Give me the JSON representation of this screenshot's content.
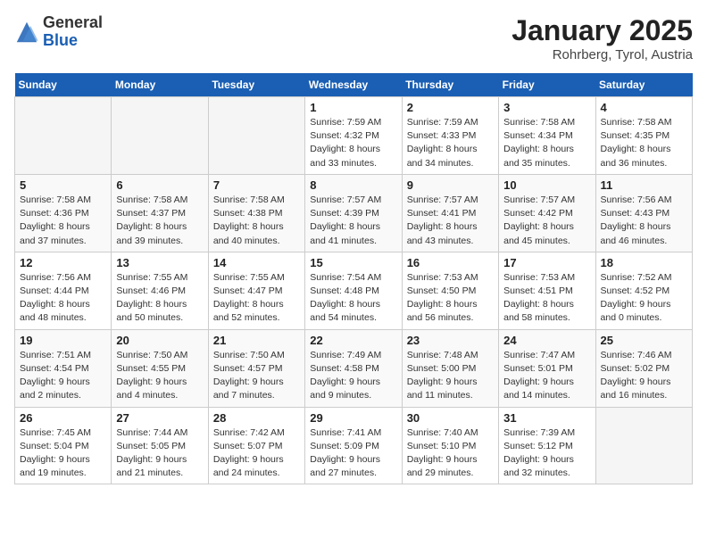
{
  "header": {
    "logo_general": "General",
    "logo_blue": "Blue",
    "title": "January 2025",
    "location": "Rohrberg, Tyrol, Austria"
  },
  "days_of_week": [
    "Sunday",
    "Monday",
    "Tuesday",
    "Wednesday",
    "Thursday",
    "Friday",
    "Saturday"
  ],
  "weeks": [
    [
      {
        "day": "",
        "empty": true
      },
      {
        "day": "",
        "empty": true
      },
      {
        "day": "",
        "empty": true
      },
      {
        "day": "1",
        "sunrise": "7:59 AM",
        "sunset": "4:32 PM",
        "daylight": "8 hours and 33 minutes."
      },
      {
        "day": "2",
        "sunrise": "7:59 AM",
        "sunset": "4:33 PM",
        "daylight": "8 hours and 34 minutes."
      },
      {
        "day": "3",
        "sunrise": "7:58 AM",
        "sunset": "4:34 PM",
        "daylight": "8 hours and 35 minutes."
      },
      {
        "day": "4",
        "sunrise": "7:58 AM",
        "sunset": "4:35 PM",
        "daylight": "8 hours and 36 minutes."
      }
    ],
    [
      {
        "day": "5",
        "sunrise": "7:58 AM",
        "sunset": "4:36 PM",
        "daylight": "8 hours and 37 minutes."
      },
      {
        "day": "6",
        "sunrise": "7:58 AM",
        "sunset": "4:37 PM",
        "daylight": "8 hours and 39 minutes."
      },
      {
        "day": "7",
        "sunrise": "7:58 AM",
        "sunset": "4:38 PM",
        "daylight": "8 hours and 40 minutes."
      },
      {
        "day": "8",
        "sunrise": "7:57 AM",
        "sunset": "4:39 PM",
        "daylight": "8 hours and 41 minutes."
      },
      {
        "day": "9",
        "sunrise": "7:57 AM",
        "sunset": "4:41 PM",
        "daylight": "8 hours and 43 minutes."
      },
      {
        "day": "10",
        "sunrise": "7:57 AM",
        "sunset": "4:42 PM",
        "daylight": "8 hours and 45 minutes."
      },
      {
        "day": "11",
        "sunrise": "7:56 AM",
        "sunset": "4:43 PM",
        "daylight": "8 hours and 46 minutes."
      }
    ],
    [
      {
        "day": "12",
        "sunrise": "7:56 AM",
        "sunset": "4:44 PM",
        "daylight": "8 hours and 48 minutes."
      },
      {
        "day": "13",
        "sunrise": "7:55 AM",
        "sunset": "4:46 PM",
        "daylight": "8 hours and 50 minutes."
      },
      {
        "day": "14",
        "sunrise": "7:55 AM",
        "sunset": "4:47 PM",
        "daylight": "8 hours and 52 minutes."
      },
      {
        "day": "15",
        "sunrise": "7:54 AM",
        "sunset": "4:48 PM",
        "daylight": "8 hours and 54 minutes."
      },
      {
        "day": "16",
        "sunrise": "7:53 AM",
        "sunset": "4:50 PM",
        "daylight": "8 hours and 56 minutes."
      },
      {
        "day": "17",
        "sunrise": "7:53 AM",
        "sunset": "4:51 PM",
        "daylight": "8 hours and 58 minutes."
      },
      {
        "day": "18",
        "sunrise": "7:52 AM",
        "sunset": "4:52 PM",
        "daylight": "9 hours and 0 minutes."
      }
    ],
    [
      {
        "day": "19",
        "sunrise": "7:51 AM",
        "sunset": "4:54 PM",
        "daylight": "9 hours and 2 minutes."
      },
      {
        "day": "20",
        "sunrise": "7:50 AM",
        "sunset": "4:55 PM",
        "daylight": "9 hours and 4 minutes."
      },
      {
        "day": "21",
        "sunrise": "7:50 AM",
        "sunset": "4:57 PM",
        "daylight": "9 hours and 7 minutes."
      },
      {
        "day": "22",
        "sunrise": "7:49 AM",
        "sunset": "4:58 PM",
        "daylight": "9 hours and 9 minutes."
      },
      {
        "day": "23",
        "sunrise": "7:48 AM",
        "sunset": "5:00 PM",
        "daylight": "9 hours and 11 minutes."
      },
      {
        "day": "24",
        "sunrise": "7:47 AM",
        "sunset": "5:01 PM",
        "daylight": "9 hours and 14 minutes."
      },
      {
        "day": "25",
        "sunrise": "7:46 AM",
        "sunset": "5:02 PM",
        "daylight": "9 hours and 16 minutes."
      }
    ],
    [
      {
        "day": "26",
        "sunrise": "7:45 AM",
        "sunset": "5:04 PM",
        "daylight": "9 hours and 19 minutes."
      },
      {
        "day": "27",
        "sunrise": "7:44 AM",
        "sunset": "5:05 PM",
        "daylight": "9 hours and 21 minutes."
      },
      {
        "day": "28",
        "sunrise": "7:42 AM",
        "sunset": "5:07 PM",
        "daylight": "9 hours and 24 minutes."
      },
      {
        "day": "29",
        "sunrise": "7:41 AM",
        "sunset": "5:09 PM",
        "daylight": "9 hours and 27 minutes."
      },
      {
        "day": "30",
        "sunrise": "7:40 AM",
        "sunset": "5:10 PM",
        "daylight": "9 hours and 29 minutes."
      },
      {
        "day": "31",
        "sunrise": "7:39 AM",
        "sunset": "5:12 PM",
        "daylight": "9 hours and 32 minutes."
      },
      {
        "day": "",
        "empty": true
      }
    ]
  ]
}
